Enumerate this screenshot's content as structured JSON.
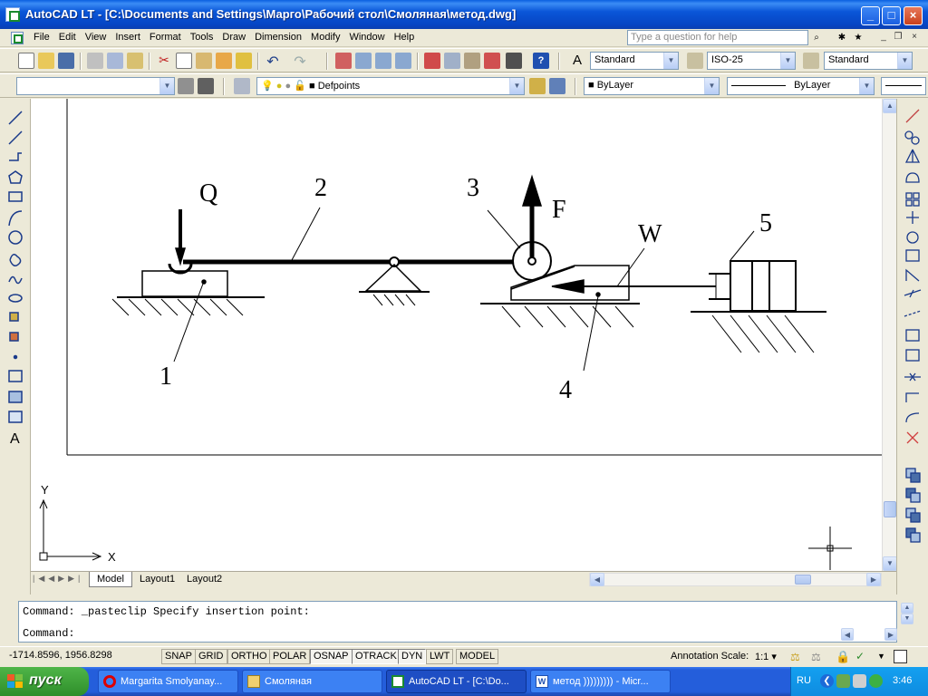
{
  "window": {
    "title": "AutoCAD LT - [C:\\Documents and Settings\\Марго\\Рабочий стол\\Смоляная\\метод.dwg]",
    "minimize": "_",
    "maximize": "□",
    "close": "×"
  },
  "menu": {
    "items": [
      "File",
      "Edit",
      "View",
      "Insert",
      "Format",
      "Tools",
      "Draw",
      "Dimension",
      "Modify",
      "Window",
      "Help"
    ],
    "help_placeholder": "Type a question for help"
  },
  "toolbar1": {
    "text_style": "Standard",
    "dim_style": "ISO-25",
    "table_style": "Standard"
  },
  "toolbar2": {
    "workspace": "",
    "layer": "Defpoints",
    "color": "ByLayer",
    "linetype": "ByLayer"
  },
  "drawing": {
    "labels": {
      "q": "Q",
      "f": "F",
      "w": "W",
      "n1": "1",
      "n2": "2",
      "n3": "3",
      "n4": "4",
      "n5": "5"
    },
    "ucs": {
      "x": "X",
      "y": "Y"
    }
  },
  "tabs": {
    "model": "Model",
    "layout1": "Layout1",
    "layout2": "Layout2"
  },
  "command": {
    "history": "Command: _pasteclip Specify insertion point:",
    "prompt": "Command:"
  },
  "status": {
    "coords": "-1714.8596, 1956.8298",
    "buttons": [
      "SNAP",
      "GRID",
      "ORTHO",
      "POLAR",
      "OSNAP",
      "OTRACK",
      "DYN",
      "LWT",
      "MODEL"
    ],
    "annotation_scale_label": "Annotation Scale:",
    "annotation_scale_value": "1:1"
  },
  "taskbar": {
    "start": "пуск",
    "tasks": [
      {
        "label": "Margarita Smolyanay...",
        "icon": "opera-icon"
      },
      {
        "label": "Смоляная",
        "icon": "folder-icon"
      },
      {
        "label": "AutoCAD LT - [C:\\Do...",
        "icon": "autocad-icon"
      },
      {
        "label": "метод ))))))))) - Micr...",
        "icon": "word-icon"
      }
    ],
    "lang": "RU",
    "clock": "3:46"
  },
  "colors": {
    "titlebar": "#0a56d8",
    "taskbar": "#245edb",
    "start": "#3c9a36",
    "tray": "#0f97e6"
  }
}
